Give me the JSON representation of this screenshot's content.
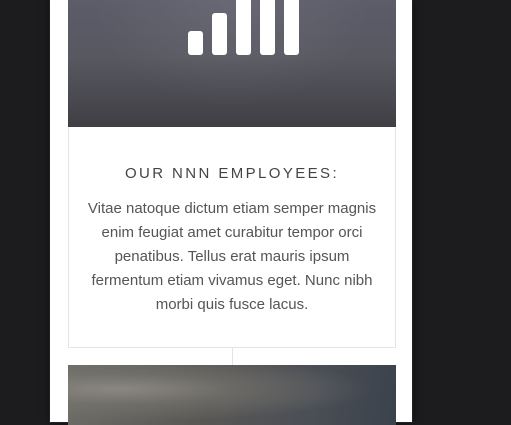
{
  "card": {
    "icon": "signal-bars-icon",
    "title": "OUR NNN EMPLOYEES:",
    "body": "Vitae natoque dictum etiam semper magnis enim feugiat amet curabitur tempor orci penatibus. Tellus erat mauris ipsum fermentum etiam vivamus eget. Nunc nibh morbi quis fusce lacus."
  },
  "colors": {
    "background": "#1c1c1e",
    "page": "#ffffff",
    "title_text": "#444444",
    "body_text": "#555555"
  }
}
